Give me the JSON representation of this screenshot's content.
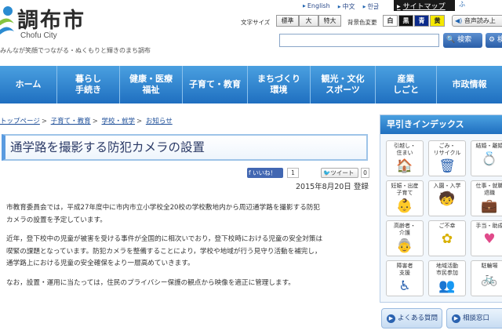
{
  "header": {
    "site_name": "調布市",
    "site_name_en": "Chofu City",
    "tagline": "みんなが笑顔でつながる・ぬくもりと輝きのまち調布",
    "languages": [
      "English",
      "中文",
      "한글"
    ],
    "sitemap": "サイトマップ",
    "ruby": "ふ",
    "text_size_label": "文字サイズ",
    "text_sizes": [
      "標準",
      "大",
      "特大"
    ],
    "bg_label": "背景色変更",
    "bg_colors": [
      "白",
      "黒",
      "青",
      "黄"
    ],
    "voice": "音声読み上",
    "search_placeholder": "",
    "search_button": "検索",
    "settings_button": "検"
  },
  "nav": [
    "ホーム",
    "暮らし\n手続き",
    "健康・医療\n福祉",
    "子育て・教育",
    "まちづくり\n環境",
    "観光・文化\nスポーツ",
    "産業\nしごと",
    "市政情報"
  ],
  "breadcrumb": [
    "トップページ",
    "子育て・教育",
    "学校・就学",
    "お知らせ"
  ],
  "article": {
    "title": "通学路を撮影する防犯カメラの設置",
    "fb_like": "いいね！",
    "fb_count": "1",
    "tweet": "ツイート",
    "tweet_count": "0",
    "date": "2015年8月20日 登録",
    "p1_line1": "市教育委員会では，平成27年度中に市内市立小学校全20校の学校敷地内から周辺通学路を撮影する防犯",
    "p1_line2": "カメラの設置を予定しています。",
    "p2_line1": "近年，登下校中の児童が被害を受ける事件が全国的に相次いでおり，登下校時における児童の安全対策は",
    "p2_line2": "喫緊の課題となっています。防犯カメラを整備することにより，学校や地域が行う見守り活動を補完し，",
    "p2_line3": "通学路上における児童の安全確保をより一層高めていきます。",
    "p3_line1": "なお，設置・運用に当たっては，住民のプライバシー保護の観点から映像を適正に管理します。"
  },
  "sidebar": {
    "heading": "早引きインデックス",
    "tiles": [
      {
        "l1": "引越し・",
        "l2": "住まい",
        "icon": "house-icon"
      },
      {
        "l1": "ごみ・",
        "l2": "リサイクル",
        "icon": "trash-icon"
      },
      {
        "l1": "結婚・離婚",
        "l2": "",
        "icon": "rings-icon"
      },
      {
        "l1": "妊娠・出産",
        "l2": "子育て",
        "icon": "baby-icon"
      },
      {
        "l1": "入園・入学",
        "l2": "",
        "icon": "child-icon"
      },
      {
        "l1": "仕事・就職",
        "l2": "退職",
        "icon": "briefcase-icon"
      },
      {
        "l1": "高齢者・",
        "l2": "介護",
        "icon": "elderly-icon"
      },
      {
        "l1": "ご不幸",
        "l2": "",
        "icon": "flower-icon"
      },
      {
        "l1": "手当・助成",
        "l2": "",
        "icon": "heart-icon"
      },
      {
        "l1": "障害者",
        "l2": "支援",
        "icon": "wheelchair-icon"
      },
      {
        "l1": "地域活動",
        "l2": "市民参加",
        "icon": "people-icon"
      },
      {
        "l1": "駐輪場",
        "l2": "",
        "icon": "bicycle-icon"
      }
    ],
    "faq": "よくある質問",
    "contact": "相談窓口"
  },
  "colors": {
    "nav_blue": "#1f6fc0",
    "link_blue": "#1e4f99",
    "title_text": "#2b3a66"
  }
}
